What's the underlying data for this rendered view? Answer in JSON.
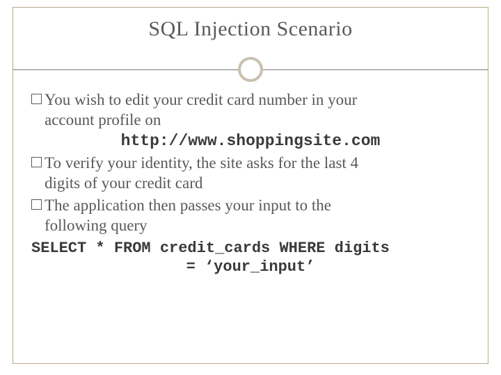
{
  "title": "SQL Injection Scenario",
  "bullets": {
    "b1a": "You wish to edit your credit card number in your",
    "b1b": "account profile on",
    "url": "http://www.shoppingsite.com",
    "b2a": "To verify your identity, the site asks for the last 4",
    "b2b": "digits of your credit card",
    "b3a": "The application then passes your input to the",
    "b3b": "following query"
  },
  "sql": {
    "line1": "SELECT * FROM credit_cards WHERE digits",
    "line2": "= ‘your_input’"
  }
}
